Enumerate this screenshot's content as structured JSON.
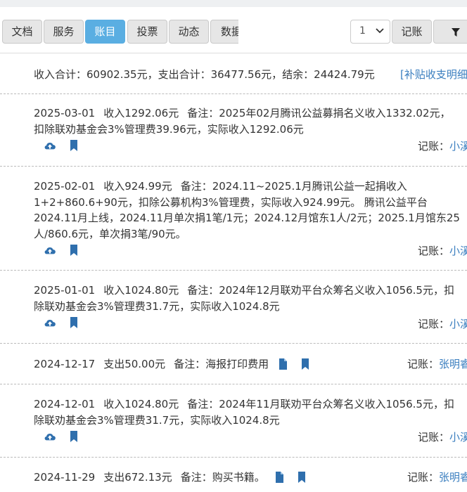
{
  "tabs": [
    {
      "label": "文档",
      "active": false
    },
    {
      "label": "服务",
      "active": false
    },
    {
      "label": "账目",
      "active": true
    },
    {
      "label": "投票",
      "active": false
    },
    {
      "label": "动态",
      "active": false
    },
    {
      "label": "数据",
      "active": false
    }
  ],
  "toolbar": {
    "page_value": "1",
    "log_label": "记账",
    "filter_icon": "filter-icon"
  },
  "summary": {
    "text": "收入合计：60902.35元，支出合计：36477.56元，结余：24424.79元",
    "link": "[补贴收支明细"
  },
  "entries": [
    {
      "date": "2025-03-01",
      "amount": "收入1292.06元",
      "line1": "备注：2025年02月腾讯公益募捐名义收入1332.02元，",
      "line2": "扣除联劝基金会3%管理费39.96元，实际收入1292.06元",
      "recorder_label": "记账：",
      "recorder_name": "小溪"
    },
    {
      "date": "2025-02-01",
      "amount": "收入924.99元",
      "line1": "备注：2024.11~2025.1月腾讯公益一起捐收入",
      "line2": "1+2+860.6+90元，扣除公募机构3%管理费，实际收入924.99元。 腾讯公益平台",
      "line3": "2024.11月上线，2024.11月单次捐1笔/1元；2024.12月馆东1人/2元；2025.1月馆东25",
      "line4": "人/860.6元，单次捐3笔/90元。",
      "recorder_label": "记账：",
      "recorder_name": "小溪"
    },
    {
      "date": "2025-01-01",
      "amount": "收入1024.80元",
      "line1": "备注：2024年12月联劝平台众筹名义收入1056.5元，扣",
      "line2": "除联劝基金会3%管理费31.7元，实际收入1024.8元",
      "recorder_label": "记账：",
      "recorder_name": "小溪"
    },
    {
      "date": "2024-12-17",
      "amount": "支出50.00元",
      "line1": "备注：海报打印费用",
      "recorder_label": "记账：",
      "recorder_name": "张明睿"
    },
    {
      "date": "2024-12-01",
      "amount": "收入1024.80元",
      "line1": "备注：2024年11月联劝平台众筹名义收入1056.5元，扣",
      "line2": "除联劝基金会3%管理费31.7元，实际收入1024.8元",
      "recorder_label": "记账：",
      "recorder_name": "小溪"
    },
    {
      "date": "2024-11-29",
      "amount": "支出672.13元",
      "line1": "备注：购买书籍。",
      "recorder_label": "记账：",
      "recorder_name": "张明睿"
    }
  ],
  "colors": {
    "accent": "#5aaee2",
    "link": "#3a7ebf",
    "icon": "#2f6fad"
  }
}
